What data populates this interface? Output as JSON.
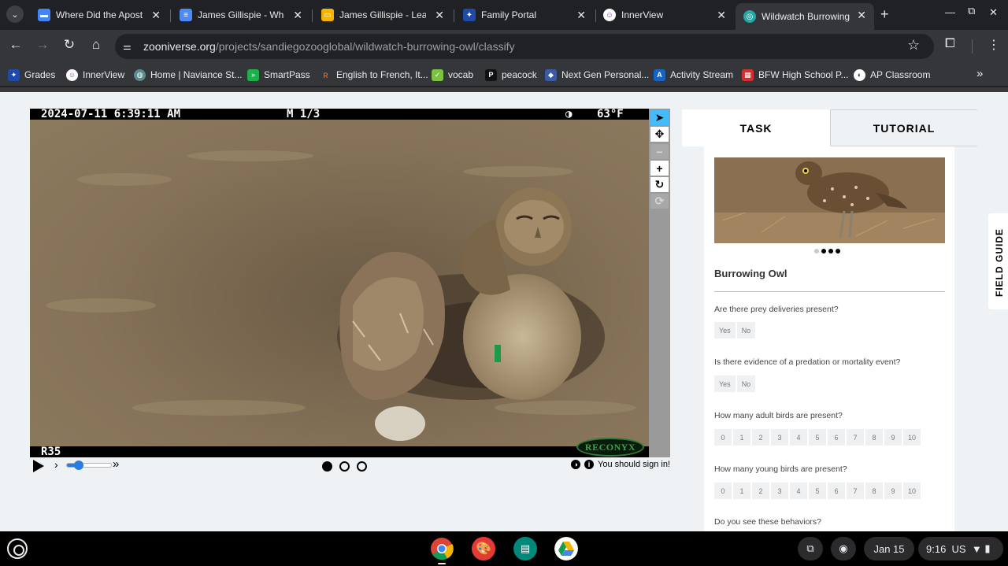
{
  "browser": {
    "tabs": [
      {
        "title": "Where Did the Apostle",
        "favicon_color": "#4285f4",
        "favicon": "slides-icon"
      },
      {
        "title": "James Gillispie - Where",
        "favicon_color": "#4c8bf5",
        "favicon": "docs-icon"
      },
      {
        "title": "James Gillispie - Leade",
        "favicon_color": "#f4b400",
        "favicon": "slides-icon"
      },
      {
        "title": "Family Portal",
        "favicon_color": "#1f4aa8",
        "favicon": "portal-icon"
      },
      {
        "title": "InnerView",
        "favicon_color": "#ffffff",
        "favicon": "innerview-icon"
      },
      {
        "title": "Wildwatch Burrowing",
        "favicon_color": "#26a8a8",
        "favicon": "zooniverse-icon"
      }
    ],
    "url_host": "zooniverse.org",
    "url_path": "/projects/sandiegozooglobal/wildwatch-burrowing-owl/classify",
    "bookmarks": [
      {
        "label": "Grades",
        "color": "#1f4aa8"
      },
      {
        "label": "InnerView",
        "color": "#ffffff"
      },
      {
        "label": "Home | Naviance St...",
        "color": "#5b8c8c"
      },
      {
        "label": "SmartPass",
        "color": "#19b34a"
      },
      {
        "label": "English to French, It...",
        "color": "#ff6a00"
      },
      {
        "label": "vocab",
        "color": "#7cc242"
      },
      {
        "label": "peacock",
        "color": "#111111"
      },
      {
        "label": "Next Gen Personal...",
        "color": "#3b5ba5"
      },
      {
        "label": "Activity Stream",
        "color": "#1565c0"
      },
      {
        "label": "BFW High School P...",
        "color": "#d32f2f"
      },
      {
        "label": "AP Classroom",
        "color": "#ffffff"
      }
    ]
  },
  "camera": {
    "timestamp": "2024-07-11 6:39:11 AM",
    "mode": "M 1/3",
    "temperature": "63°F",
    "camera_id": "R35",
    "brand": "RECONYX"
  },
  "player": {
    "signin_text": "You should sign in!",
    "frames_total": 3,
    "frame_current": 1,
    "speed_level": 0.2
  },
  "task": {
    "tab_task": "TASK",
    "tab_tutorial": "TUTORIAL",
    "species": "Burrowing Owl",
    "carousel_dots": 4,
    "carousel_active": 1,
    "questions": [
      {
        "text": "Are there prey deliveries present?",
        "answers": [
          "Yes",
          "No"
        ]
      },
      {
        "text": "Is there evidence of a predation or mortality event?",
        "answers": [
          "Yes",
          "No"
        ]
      },
      {
        "text": "How many adult birds are present?",
        "answers": [
          "0",
          "1",
          "2",
          "3",
          "4",
          "5",
          "6",
          "7",
          "8",
          "9",
          "10"
        ]
      },
      {
        "text": "How many young birds are present?",
        "answers": [
          "0",
          "1",
          "2",
          "3",
          "4",
          "5",
          "6",
          "7",
          "8",
          "9",
          "10"
        ]
      },
      {
        "text": "Do you see these behaviors?",
        "answers": []
      }
    ],
    "field_guide": "FIELD GUIDE"
  },
  "shelf": {
    "date": "Jan 15",
    "time": "9:16",
    "locale": "US"
  }
}
